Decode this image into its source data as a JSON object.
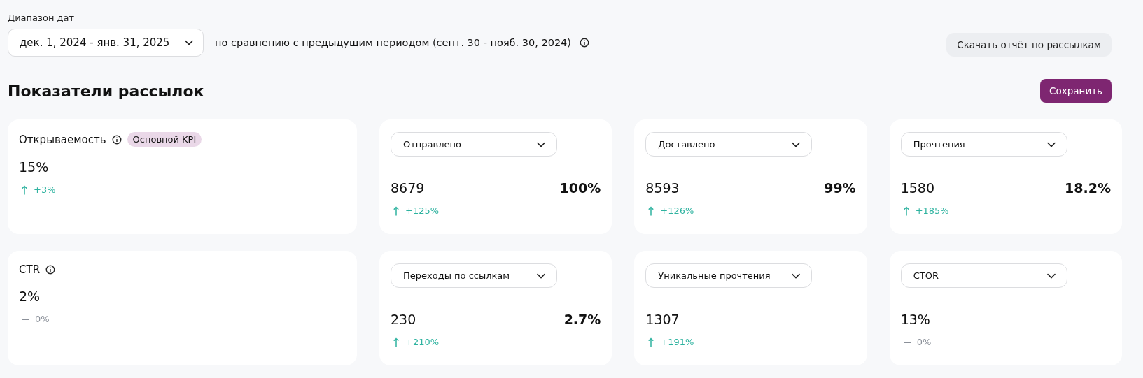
{
  "date_range": {
    "label": "Диапазон дат",
    "value": "дек. 1, 2024 - янв. 31, 2025",
    "comparison": "по сравнению с предыдущим периодом (сент. 30 - нояб. 30, 2024)"
  },
  "download_button": "Скачать отчёт по рассылкам",
  "heading": "Показатели рассылок",
  "save_button": "Сохранить",
  "metric_cards": [
    {
      "kind": "kpi",
      "title": "Открываемость",
      "badge": "Основной KPI",
      "value": "15%",
      "trend": {
        "kind": "up",
        "text": "+3%"
      }
    },
    {
      "kind": "select",
      "select": "Отправлено",
      "value": "8679",
      "share": "100%",
      "trend": {
        "kind": "up",
        "text": "+125%"
      }
    },
    {
      "kind": "select",
      "select": "Доставлено",
      "value": "8593",
      "share": "99%",
      "trend": {
        "kind": "up",
        "text": "+126%"
      }
    },
    {
      "kind": "select",
      "select": "Прочтения",
      "value": "1580",
      "share": "18.2%",
      "trend": {
        "kind": "up",
        "text": "+185%"
      }
    },
    {
      "kind": "kpi",
      "title": "CTR",
      "value": "2%",
      "trend": {
        "kind": "flat",
        "text": "0%"
      }
    },
    {
      "kind": "select",
      "select": "Переходы по ссылкам",
      "value": "230",
      "share": "2.7%",
      "trend": {
        "kind": "up",
        "text": "+210%"
      }
    },
    {
      "kind": "select",
      "select": "Уникальные прочтения",
      "value": "1307",
      "trend": {
        "kind": "up",
        "text": "+191%"
      }
    },
    {
      "kind": "select",
      "select": "CTOR",
      "value": "13%",
      "trend": {
        "kind": "flat",
        "text": "0%"
      }
    }
  ]
}
